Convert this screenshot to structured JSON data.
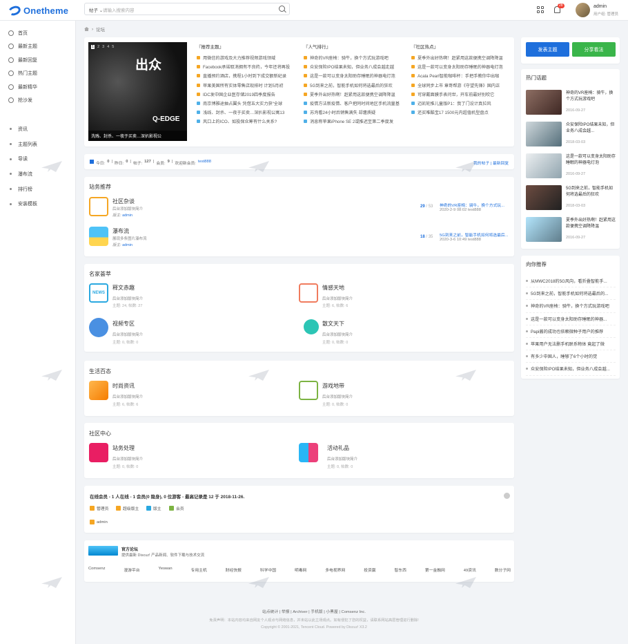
{
  "brand": {
    "logo_text": "Onetheme",
    "accent": "#1e6fdc"
  },
  "search": {
    "scope": "帖子 ⌄",
    "placeholder": "请输入搜索内容"
  },
  "header": {
    "notify_count": "28",
    "username": "admin",
    "user_role": "用户组: 管理员"
  },
  "sidebar": {
    "main": [
      "首页",
      "最新主题",
      "最新回复",
      "热门主题",
      "最新精华",
      "抢沙发"
    ],
    "sub": [
      "资讯",
      "主题列表",
      "导读",
      "瀑布流",
      "排行榜",
      "安装模板"
    ]
  },
  "breadcrumb": {
    "home_icon": "home-icon",
    "current": "论坛"
  },
  "slider": {
    "pages": [
      "1",
      "2",
      "3",
      "4",
      "5"
    ],
    "brand": "出众",
    "edge": "Q-EDGE",
    "caption": "洗贱、封杀、一夜于买卖…深扒影视公"
  },
  "news": {
    "col1": {
      "title": "『推荐主题』",
      "items": [
        "用微信的游戏及大力推荐视频游戏领域",
        "Facebook承诺取消拥有不良药，今年还将再投",
        "直播预约酒店，携程1小时到下成交额新纪录",
        "苹果美国所有实体零售店现排时 计划5月初",
        "IDC发中国企业医存储2019四季度报告",
        "南京博雅途抽占翼头 凭借五大实力获“全球",
        "浅线、封杀、一夜于买卖…深扒影视公寓13",
        "风口上的ICO、如投保众筹有什么关系?"
      ]
    },
    "col2": {
      "title": "『人气排行』",
      "items": [
        "神奇的VR座椅：骑牛，换个方式玩游戏吧",
        "众安保险IPO结果未知，但业务八成会越走越",
        "这是一款可以变身太阳助存睡眠的神器电灯泡",
        "5G到来之前，智能手机如何将选最后的狂欢",
        "夏季外出好热啊！赶紧用这款便携空调降降温",
        "疫情方法新疫情、客户把同时间地区手机流量基",
        "苏洵看24小时后销售满失 却遭质疑",
        "消息称苹果iPhone SE 2或推迟至第二季度发"
      ]
    },
    "col3": {
      "title": "『社区热点』",
      "items": [
        "夏季外出好热啊！赶紧用这款便携空调降降温",
        "这是一款可以变身太阳助存睡眠的神器电灯泡",
        "Acala Pearl智能咖啡杯：手把手教你中出咖",
        "全球同步上市 章哥帮游《守望先锋》国内正",
        "可穿戴面膜手表问世，开车前最好别吹它",
        "迈凯轮推儿童版P1：我了门设计真拉风",
        "还买唯酷宝17 1500元内超值机型盘点",
        ""
      ]
    }
  },
  "stats": {
    "today_label": "今日:",
    "today": "0",
    "yesterday_label": "昨日:",
    "yesterday": "0",
    "posts_label": "帖子:",
    "posts": "127",
    "members_label": "会员:",
    "members": "9",
    "welcome": "欢迎新会员:",
    "newest": "test888",
    "my_posts": "我的帖子",
    "latest_reply": "最新回复"
  },
  "sections": {
    "s1": {
      "title": "站务推荐",
      "forums": [
        {
          "name": "社区杂谈",
          "desc": "后台添加版块简介",
          "mod_label": "版主:",
          "mod": "admin",
          "count": "29",
          "count_total": "53",
          "last": "神奇的VR座椅：骑牛，换个方式玩...",
          "last_date": "2020-2-9 08:02 test888"
        },
        {
          "name": "瀑布流",
          "desc": "展现多条图片瀑布流",
          "mod_label": "版主:",
          "mod": "admin",
          "count": "18",
          "count_total": "35",
          "last": "5G到来之前，智能手机如何将选最后...",
          "last_date": "2020-3-6 10:49 test888"
        }
      ]
    },
    "s2": {
      "title": "名家荟萃",
      "forums": [
        {
          "name": "释文赤趣",
          "desc": "后台添加版块简介",
          "stat": "主题: 24, 帖数: 27"
        },
        {
          "name": "情感天地",
          "desc": "后台添加版块简介",
          "stat": "主题: 6, 帖数: 6"
        },
        {
          "name": "视频专区",
          "desc": "后台添加版块简介",
          "stat": "主题: 0, 帖数: 0"
        },
        {
          "name": "散文天下",
          "desc": "后台添加版块简介",
          "stat": "主题: 0, 帖数: 0"
        }
      ]
    },
    "s3": {
      "title": "生活百态",
      "forums": [
        {
          "name": "时尚资讯",
          "desc": "后台添加版块简介",
          "stat": "主题: 6, 帖数: 6"
        },
        {
          "name": "游戏地带",
          "desc": "后台添加版块简介",
          "stat": "主题: 0, 帖数: 0"
        }
      ]
    },
    "s4": {
      "title": "社区中心",
      "forums": [
        {
          "name": "站务处理",
          "desc": "后台添加版块简介",
          "stat": "主题: 0, 帖数: 0"
        },
        {
          "name": "活动礼品",
          "desc": "后台添加版块简介",
          "stat": "主题: 0, 帖数: 0"
        }
      ]
    }
  },
  "right": {
    "post_btn": "发表主题",
    "share_btn": "分享看法",
    "hot_title": "热门话题",
    "hot": [
      {
        "title": "神奇的VR座椅：骑牛，换个方式玩游戏吧",
        "date": "2016-09-27"
      },
      {
        "title": "众安保险IPO结果未知，但业务八成会越...",
        "date": "2018-03-03"
      },
      {
        "title": "这是一款可以变身太阳助存睡眠的神器电灯泡",
        "date": "2016-09-27"
      },
      {
        "title": "5G到来之前，智能手机如何将选最后的狂欢",
        "date": "2018-03-03"
      },
      {
        "title": "夏季外出好热啊！赶紧用这款便携空调降降温",
        "date": "2016-09-27"
      }
    ],
    "rec_title": "向你推荐",
    "rec": [
      "从MWC2018的5G风向，看折叠智能手...",
      "5G到来之前，智能手机如何将选最后的...",
      "神奇的VR座椅：骑牛，换个方式玩游戏吧",
      "这是一款可以变身太阳助存睡眠的神器...",
      "Papi酱的成功也依赖微种子用户的推荐",
      "苹果用户无法删手机联系物体 竟起了微",
      "有多少中国人，睡够了6个小时的觉",
      "众安保险IPO结果未知，但业务八成会越..."
    ]
  },
  "online": {
    "title": "在线会员 - 1 人在线 - 1 会员(0 隐身), 0 位游客 - 最高记录是 12 于 2018-11-26.",
    "legend": [
      "管理员",
      "超级版主",
      "版主",
      "会员"
    ],
    "user": "admin"
  },
  "friend": {
    "name": "官方论坛",
    "desc": "提供最新 Discuz! 产品新闻、软件下载与技术交流",
    "links": [
      "Comsenz",
      "漫游平台",
      "Yeswan",
      "专用主机",
      "财经快报",
      "科学中国",
      "明毒网",
      "多电视界网",
      "投资赢",
      "智东西",
      "第一金融网",
      "49资讯",
      "数分子网"
    ]
  },
  "footer": {
    "links": "站点统计 | 举报 | Archiver | 手机版 | 小黑屋 | Comsenz Inc.",
    "disclaimer": "免责声明：本站内容均来自网友个人观点与网络信息，并未站以此立场观点。如有侵犯了您的权益，请联系网站高层管理进行删除!",
    "copyright": "Copyright © 2001-2021, Tencent Cloud. Powered by Discuz! X3.2"
  }
}
